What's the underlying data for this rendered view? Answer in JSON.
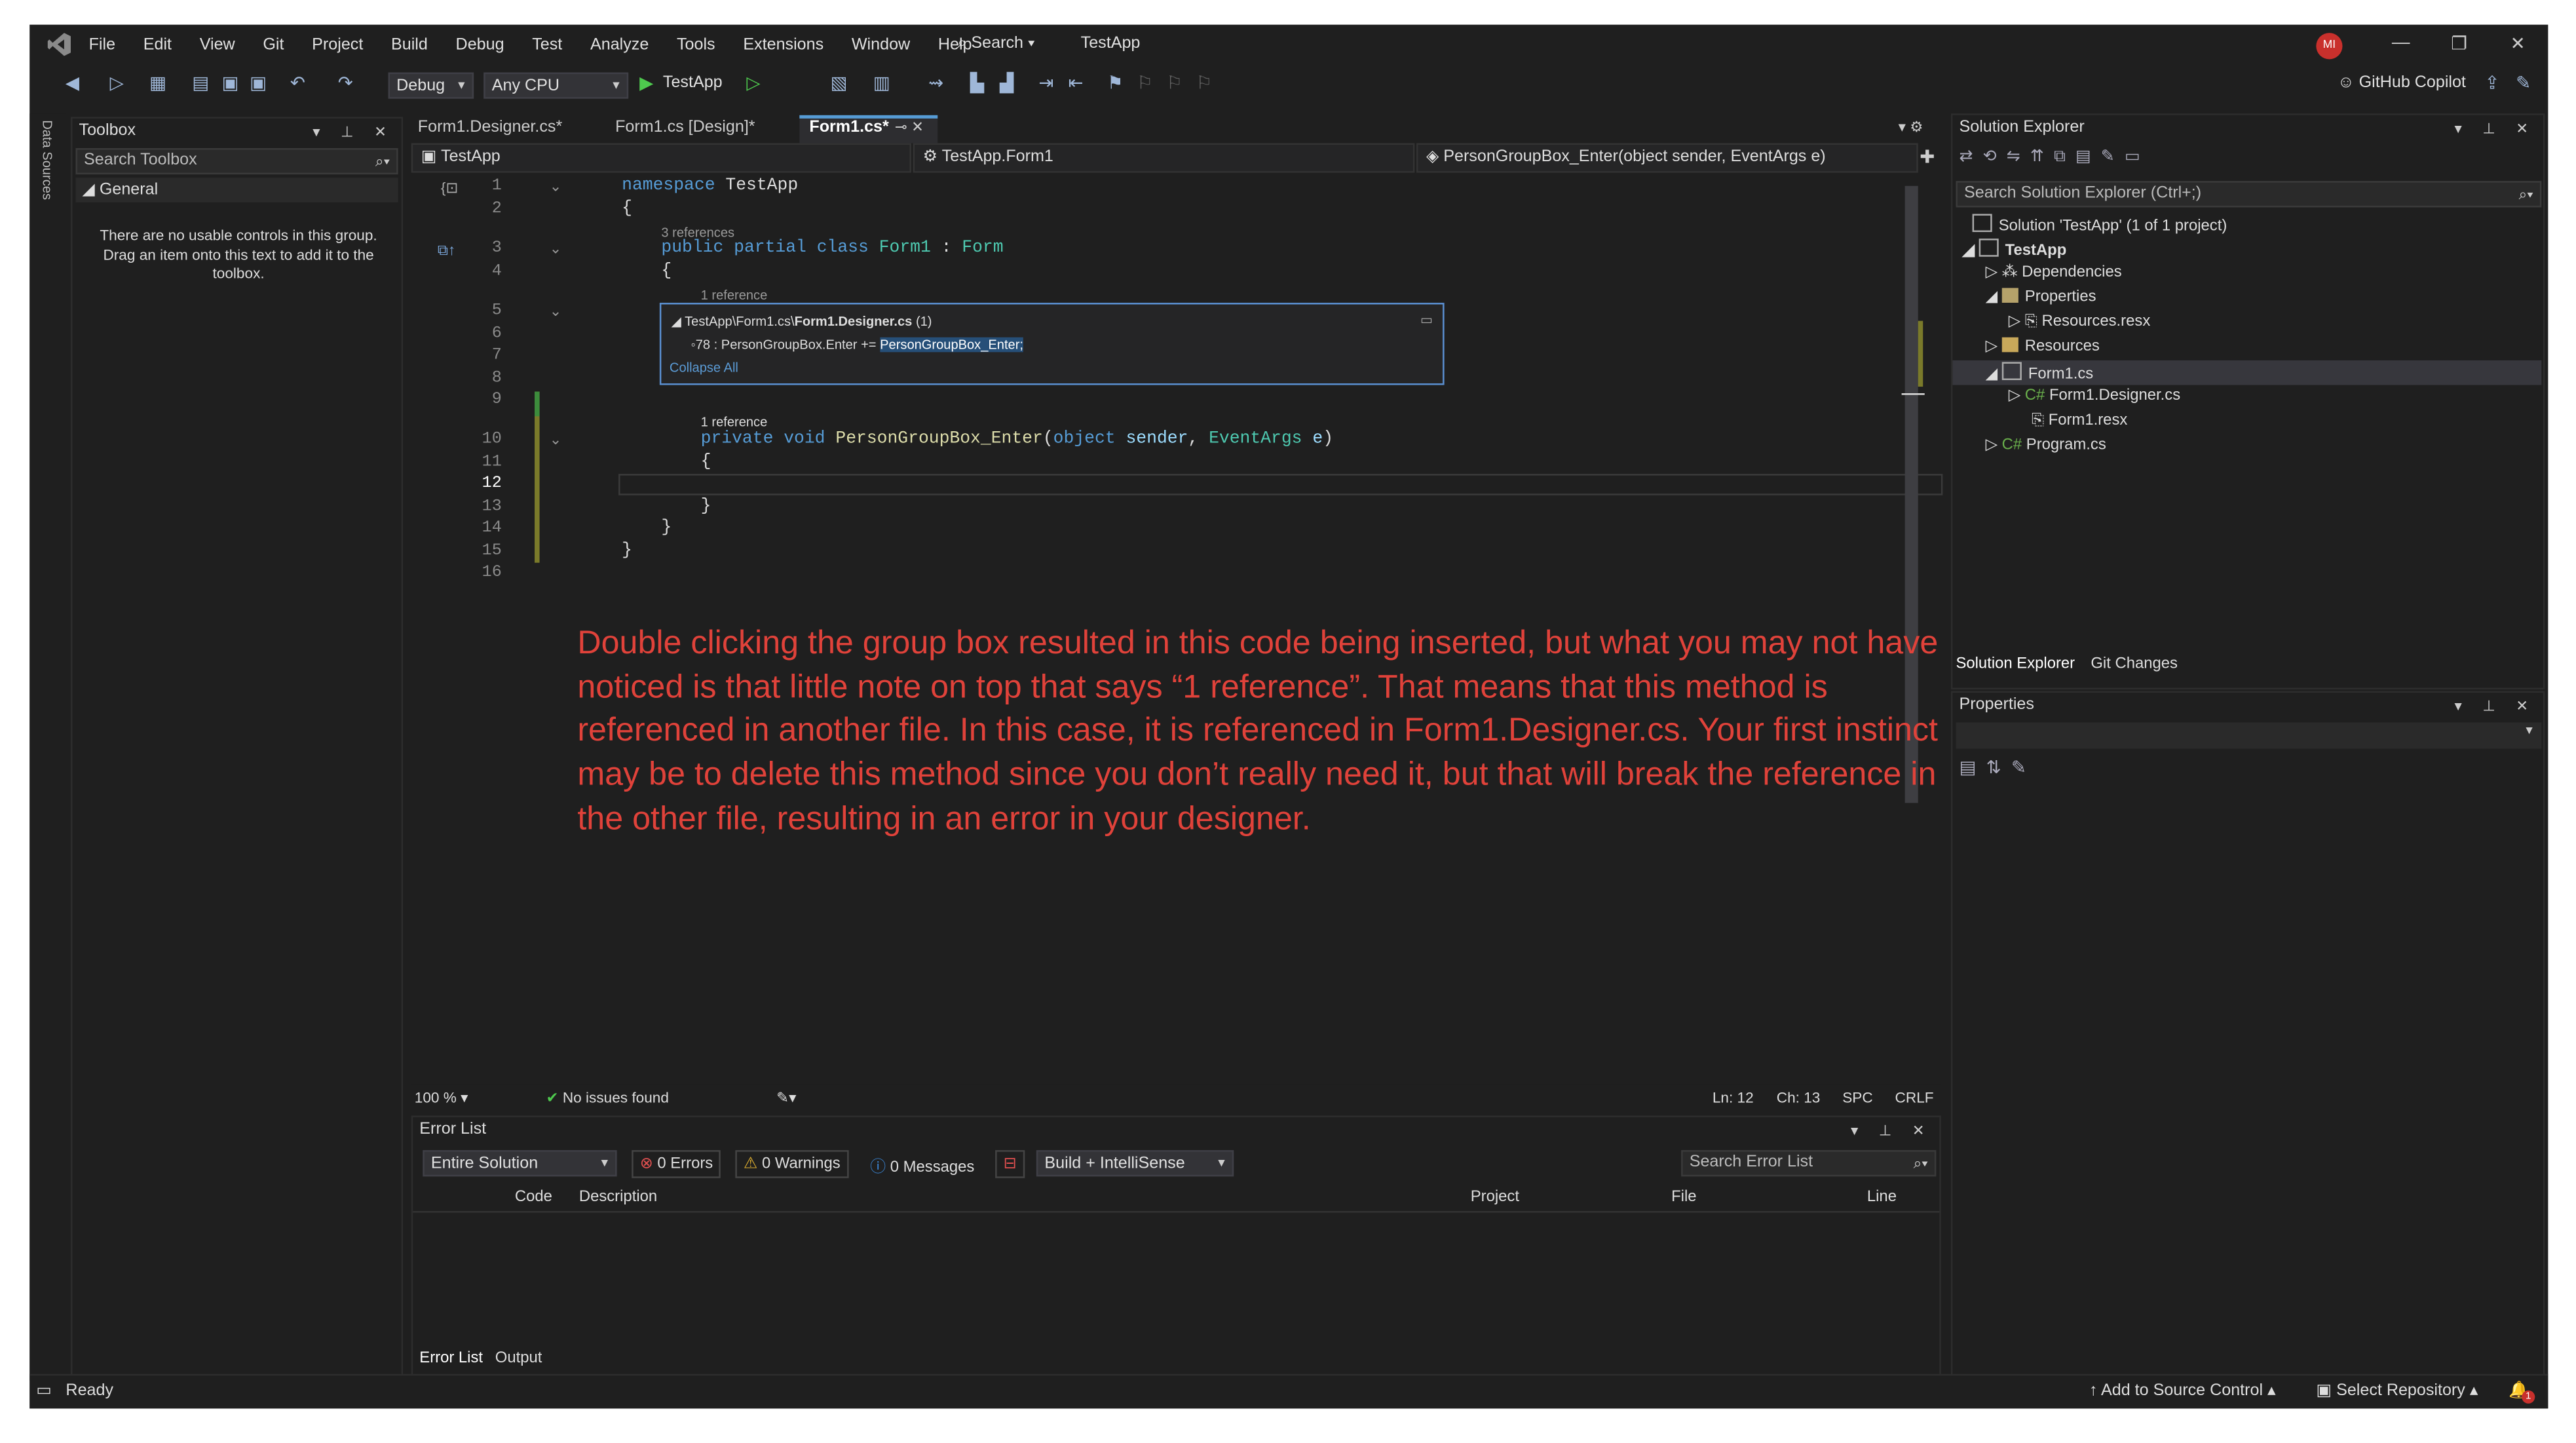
{
  "menubar": {
    "items": [
      "File",
      "Edit",
      "View",
      "Git",
      "Project",
      "Build",
      "Debug",
      "Test",
      "Analyze",
      "Tools",
      "Extensions",
      "Window",
      "Help"
    ],
    "search_label": "Search",
    "app_title": "TestApp",
    "avatar_initials": "MI"
  },
  "toolbar": {
    "config": "Debug",
    "platform": "Any CPU",
    "run_target": "TestApp",
    "copilot": "GitHub Copilot"
  },
  "side_strip": "Data Sources",
  "toolbox": {
    "title": "Toolbox",
    "search_placeholder": "Search Toolbox",
    "group": "General",
    "empty_message": "There are no usable controls in this group. Drag an item onto this text to add it to the toolbox."
  },
  "editor_tabs": [
    {
      "label": "Form1.Designer.cs*",
      "active": false
    },
    {
      "label": "Form1.cs [Design]*",
      "active": false
    },
    {
      "label": "Form1.cs*",
      "active": true
    }
  ],
  "navbar": {
    "project": "TestApp",
    "class": "TestApp.Form1",
    "member": "PersonGroupBox_Enter(object sender, EventArgs e)"
  },
  "code": {
    "line_numbers": [
      "1",
      "2",
      "3",
      "4",
      "5",
      "6",
      "7",
      "8",
      "9",
      "10",
      "11",
      "12",
      "13",
      "14",
      "15",
      "16"
    ],
    "ref3": "3 references",
    "ref1a": "1 reference",
    "ref1b": "1 reference",
    "namespace_kw": "namespace",
    "namespace_name": "TestApp",
    "class_line": {
      "mods": "public partial class",
      "name": "Form1",
      "colon": " : ",
      "base": "Form"
    },
    "method_line": {
      "mods": "private void",
      "name": "PersonGroupBox_Enter",
      "p1type": "object",
      "p1": "sender",
      "p2type": "EventArgs",
      "p2": "e"
    }
  },
  "peek": {
    "path_prefix": "TestApp\\Form1.cs\\",
    "file": "Form1.Designer.cs",
    "count": "(1)",
    "line_prefix": "78 : PersonGroupBox.Enter += ",
    "line_highlight": "PersonGroupBox_Enter;",
    "collapse": "Collapse All"
  },
  "annotation": "Double clicking the group box resulted in this code being inserted, but what you may not have noticed is that little note on top that says “1 reference”. That means that this method is referenced in another file. In this case, it is referenced in Form1.Designer.cs. Your first instinct may be to delete this method since you don’t really need it, but that will break the reference in the other file, resulting in an error in your designer.",
  "editor_status": {
    "zoom": "100 %",
    "issues": "No issues found",
    "ln": "Ln: 12",
    "ch": "Ch: 13",
    "spc": "SPC",
    "crlf": "CRLF"
  },
  "error_list": {
    "title": "Error List",
    "scope": "Entire Solution",
    "errors": "0 Errors",
    "warnings": "0 Warnings",
    "messages": "0 Messages",
    "filter": "Build + IntelliSense",
    "search_placeholder": "Search Error List",
    "columns": [
      "Code",
      "Description",
      "Project",
      "File",
      "Line"
    ],
    "tabs": [
      "Error List",
      "Output"
    ]
  },
  "solution_explorer": {
    "title": "Solution Explorer",
    "search_placeholder": "Search Solution Explorer (Ctrl+;)",
    "items": [
      {
        "label": "Solution 'TestApp' (1 of 1 project)",
        "bold": false
      },
      {
        "label": "TestApp",
        "bold": true
      },
      {
        "label": "Dependencies",
        "bold": false
      },
      {
        "label": "Properties",
        "bold": false
      },
      {
        "label": "Resources.resx",
        "bold": false
      },
      {
        "label": "Resources",
        "bold": false
      },
      {
        "label": "Form1.cs",
        "bold": false
      },
      {
        "label": "Form1.Designer.cs",
        "bold": false
      },
      {
        "label": "Form1.resx",
        "bold": false
      },
      {
        "label": "Program.cs",
        "bold": false
      }
    ],
    "tabs": [
      "Solution Explorer",
      "Git Changes"
    ]
  },
  "properties": {
    "title": "Properties"
  },
  "statusbar": {
    "ready": "Ready",
    "source_control": "Add to Source Control",
    "repo": "Select Repository",
    "notif_count": "1"
  },
  "colors": {
    "accent": "#569cd6",
    "annotation": "#e0423a",
    "error": "#c9302c"
  }
}
